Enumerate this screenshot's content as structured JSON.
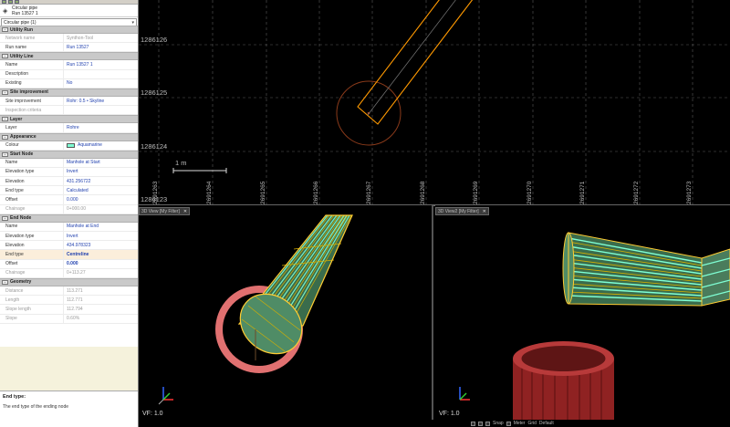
{
  "header": {
    "type": "Circular pipe",
    "run": "Run 13527 1",
    "icon": "pipe-icon"
  },
  "selector": {
    "value": "Circular pipe (1)"
  },
  "sections": {
    "utility_run": {
      "title": "Utility Run",
      "network_name_label": "Network name",
      "network_name_value": "Synthon-Tool",
      "run_name_label": "Run name",
      "run_name_value": "Run 13527"
    },
    "utility_line": {
      "title": "Utility Line",
      "name_label": "Name",
      "name_value": "Run 13527 1",
      "description_label": "Description",
      "description_value": "",
      "existing_label": "Existing",
      "existing_value": "No"
    },
    "site_improvement": {
      "title": "Site improvement",
      "site_label": "Site improvement",
      "site_value": "Rohr: 0.5 • Skyline",
      "inspection_label": "Inspection criteria",
      "inspection_value": ""
    },
    "layer": {
      "title": "Layer",
      "layer_label": "Layer",
      "layer_value": "Rohre"
    },
    "appearance": {
      "title": "Appearance",
      "colour_label": "Colour",
      "colour_value": "Aquamarine",
      "colour_hex": "#7fffd4"
    },
    "start_node": {
      "title": "Start Node",
      "name_label": "Name",
      "name_value": "Manhole at Start",
      "elev_type_label": "Elevation type",
      "elev_type_value": "Invert",
      "elevation_label": "Elevation",
      "elevation_value": "431.256722",
      "end_type_label": "End type",
      "end_type_value": "Calculated",
      "offset_label": "Offset",
      "offset_value": "0.000",
      "chainage_label": "Chainage",
      "chainage_value": "0+000.00"
    },
    "end_node": {
      "title": "End Node",
      "name_label": "Name",
      "name_value": "Manhole at End",
      "elev_type_label": "Elevation type",
      "elev_type_value": "Invert",
      "elevation_label": "Elevation",
      "elevation_value": "434.978323",
      "end_type_label": "End type",
      "end_type_value": "Centreline",
      "offset_label": "Offset",
      "offset_value": "0.000",
      "chainage_label": "Chainage",
      "chainage_value": "0+113.27"
    },
    "geometry": {
      "title": "Geometry",
      "distance_label": "Distance",
      "distance_value": "113.271",
      "length_label": "Length",
      "length_value": "112.771",
      "slope_length_label": "Slope length",
      "slope_length_value": "112.794",
      "slope_label": "Slope",
      "slope_value": "0.60%"
    }
  },
  "help": {
    "title": "End type:",
    "description": "The end type of the ending node"
  },
  "plan_view": {
    "y_labels": [
      "1286126",
      "1286125",
      "1286124",
      "1286123"
    ],
    "x_labels": [
      "2691263",
      "2691264",
      "2691265",
      "2691266",
      "2691267",
      "2691268",
      "2691269",
      "2691270",
      "2691271",
      "2691272",
      "2691273"
    ],
    "scale_label": "1 m"
  },
  "view3d": {
    "tab_title": "3D View [My Filter]",
    "close": "✕",
    "vf": "VF: 1.0"
  },
  "view3d2": {
    "tab_title": "3D View2 [My Filter]",
    "close": "✕",
    "vf": "VF: 1.0"
  },
  "status": {
    "snap": "Snap",
    "meter": "Meter",
    "grid": "Grid",
    "default": "Default"
  },
  "colors": {
    "pipe_outline": "#ff9900",
    "pipe_fill": "#7fffd4",
    "manhole_ring": "#e07070"
  }
}
